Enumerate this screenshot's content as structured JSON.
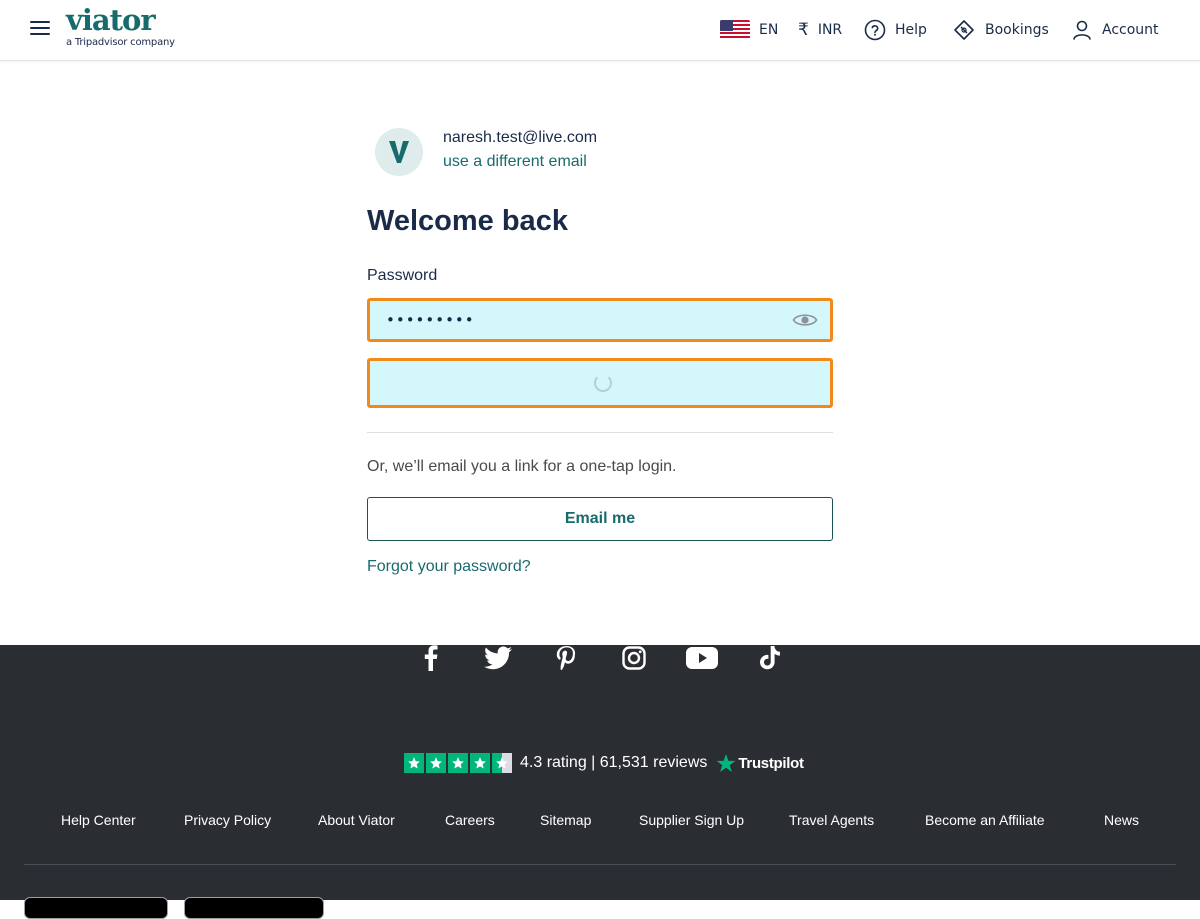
{
  "header": {
    "logo_text": "viator",
    "logo_subtext": "a Tripadvisor company",
    "nav": {
      "language": "EN",
      "currency_symbol": "₹",
      "currency": "INR",
      "help": "Help",
      "bookings": "Bookings",
      "account": "Account"
    }
  },
  "login": {
    "avatar_letter": "V",
    "email": "naresh.test@live.com",
    "different_email": "use a different email",
    "title": "Welcome back",
    "password_label": "Password",
    "password_value": "•••••••••",
    "onetap_text": "Or, we’ll email you a link for a one-tap login.",
    "email_me": "Email me",
    "forgot": "Forgot your password?"
  },
  "footer": {
    "social": [
      "facebook",
      "twitter",
      "pinterest",
      "instagram",
      "youtube",
      "tiktok"
    ],
    "rating": {
      "value": 4.3,
      "stars_filled": 4.5,
      "text": "4.3 rating | 61,531 reviews",
      "provider": "Trustpilot"
    },
    "links": [
      "Help Center",
      "Privacy Policy",
      "About Viator",
      "Careers",
      "Sitemap",
      "Supplier Sign Up",
      "Travel Agents",
      "Become an Affiliate",
      "News"
    ]
  },
  "colors": {
    "brand": "#186b6d",
    "focus_border": "#f28a1a",
    "field_fill": "#d4f7fb",
    "footer_bg": "#2a2d32",
    "trustpilot_green": "#00b67a"
  }
}
